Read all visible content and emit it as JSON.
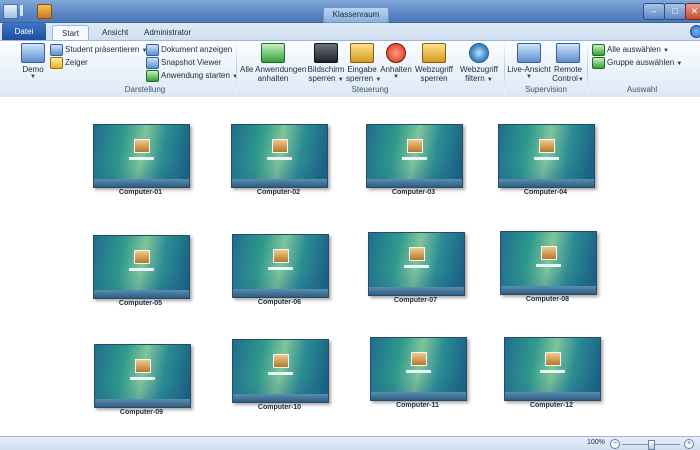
{
  "window": {
    "title": "Klassenraum"
  },
  "tabs": {
    "datei": "Datei",
    "start": "Start",
    "ansicht": "Ansicht",
    "administrator": "Administrator"
  },
  "ribbon": {
    "darstellung": {
      "group_label": "Darstellung",
      "demo": "Demo",
      "student_present": "Student präsentieren",
      "pointer": "Zeiger",
      "show_document": "Dokument anzeigen",
      "snapshot_viewer": "Snapshot Viewer",
      "start_application": "Anwendung starten"
    },
    "steuerung": {
      "group_label": "Steuerung",
      "stop_all_apps_line1": "Alle Anwendungen",
      "stop_all_apps_line2": "anhalten",
      "lock_screen_line1": "Bildschirm",
      "lock_screen_line2": "sperren",
      "lock_input_line1": "Eingabe",
      "lock_input_line2": "sperren",
      "stop_line1": "Anhalten",
      "lock_web_line1": "Webzugriff",
      "lock_web_line2": "sperren",
      "filter_web_line1": "Webzugriff",
      "filter_web_line2": "filtern"
    },
    "supervision": {
      "group_label": "Supervision",
      "live_view": "Live-Ansicht",
      "remote_control_line1": "Remote",
      "remote_control_line2": "Control"
    },
    "auswahl": {
      "group_label": "Auswahl",
      "select_all": "Alle auswählen",
      "select_group": "Gruppe auswählen"
    }
  },
  "computers": [
    {
      "label": "Computer-01"
    },
    {
      "label": "Computer-02"
    },
    {
      "label": "Computer-03"
    },
    {
      "label": "Computer-04"
    },
    {
      "label": "Computer-05"
    },
    {
      "label": "Computer-06"
    },
    {
      "label": "Computer-07"
    },
    {
      "label": "Computer-08"
    },
    {
      "label": "Computer-09"
    },
    {
      "label": "Computer-10"
    },
    {
      "label": "Computer-11"
    },
    {
      "label": "Computer-12"
    }
  ],
  "statusbar": {
    "zoom_level": "100%",
    "zoom_out": "−",
    "zoom_in": "+",
    "zoom_percent": 100
  }
}
